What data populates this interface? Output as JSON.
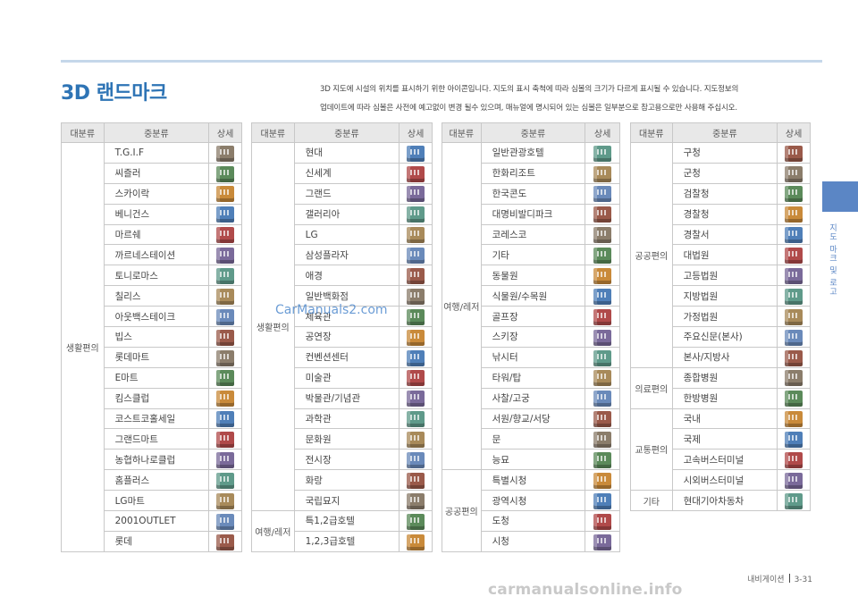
{
  "title": "3D 랜드마크",
  "intro": [
    "3D 지도에 시설의 위치를 표시하기 위한 아이콘입니다. 지도의 표시 축척에 따라 심볼의 크기가 다르게 표시될 수 있습니다. 지도정보의",
    "업데이트에 따라 심볼은 사전에 예고없이 변경 될수 있으며, 매뉴얼에 명시되어 있는 심볼은 일부분으로 참고용으로만 사용해 주십시오."
  ],
  "side_label": "지도 마크 및 로고",
  "headers": {
    "major": "대분류",
    "minor": "중분류",
    "detail": "상세"
  },
  "tables": [
    {
      "groups": [
        {
          "cat": "생활편의",
          "items": [
            "T.G.I.F",
            "씨즐러",
            "스카이락",
            "베니건스",
            "마르쉐",
            "까르네스테이션",
            "토니로마스",
            "칠리스",
            "아웃백스테이크",
            "빕스",
            "롯데마트",
            "E마트",
            "킴스클럽",
            "코스트코홀세일",
            "그랜드마트",
            "농협하나로클럽",
            "홈플러스",
            "LG마트",
            "2001OUTLET",
            "롯데"
          ]
        }
      ]
    },
    {
      "groups": [
        {
          "cat": "생활편의",
          "items": [
            "현대",
            "신세계",
            "그랜드",
            "갤러리아",
            "LG",
            "삼성플라자",
            "애경",
            "일반백화점",
            "체육관",
            "공연장",
            "컨벤션센터",
            "미술관",
            "박물관/기념관",
            "과학관",
            "문화원",
            "전시장",
            "화랑",
            "국립묘지"
          ]
        },
        {
          "cat": "여행/레저",
          "items": [
            "특1,2급호텔",
            "1,2,3급호텔"
          ]
        }
      ]
    },
    {
      "groups": [
        {
          "cat": "여행/레저",
          "items": [
            "일반관광호텔",
            "한화리조트",
            "한국콘도",
            "대명비발디파크",
            "코레스코",
            "기타",
            "동물원",
            "식물원/수목원",
            "골프장",
            "스키장",
            "낚시터",
            "타워/탑",
            "사찰/고궁",
            "서원/향교/서당",
            "문",
            "능묘"
          ]
        },
        {
          "cat": "공공편의",
          "items": [
            "특별시청",
            "광역시청",
            "도청",
            "시청"
          ]
        }
      ]
    },
    {
      "groups": [
        {
          "cat": "공공편의",
          "items": [
            "구청",
            "군청",
            "검찰청",
            "경찰청",
            "경찰서",
            "대법원",
            "고등법원",
            "지방법원",
            "가정법원",
            "주요신문(본사)",
            "본사/지방사"
          ]
        },
        {
          "cat": "의료편의",
          "items": [
            "종합병원",
            "한방병원"
          ]
        },
        {
          "cat": "교통편의",
          "items": [
            "국내",
            "국제",
            "고속버스터미널",
            "시외버스터미널"
          ]
        },
        {
          "cat": "기타",
          "items": [
            "현대기아차동차"
          ]
        }
      ]
    }
  ],
  "icon_colors": [
    "#8b7d6b",
    "#5b8a5a",
    "#c98a3a",
    "#4f7fb8",
    "#b04a4a",
    "#7a6a9a",
    "#5f9a8a",
    "#a88a5a",
    "#6a8aba",
    "#9a5a4a"
  ],
  "footer": {
    "section": "내비게이션",
    "page": "3-31"
  },
  "watermarks": {
    "mid": "CarManuals2.com",
    "bottom": "carmanualsonline.info"
  }
}
